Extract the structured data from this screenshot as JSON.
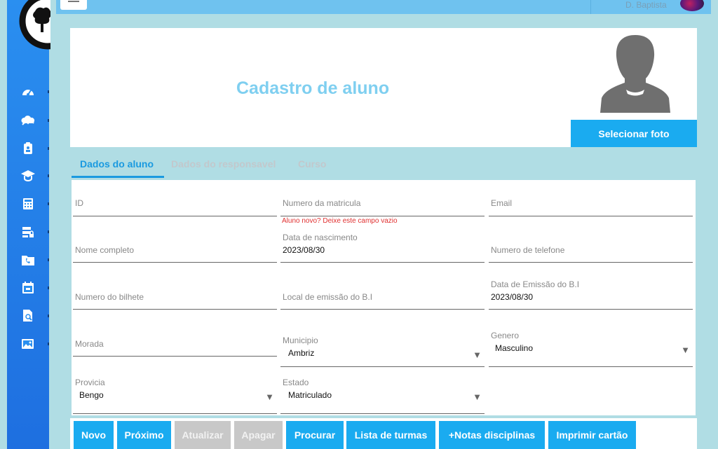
{
  "topbar": {
    "user_name": "D. Baptista"
  },
  "sidebar": {
    "items": [
      {
        "icon": "dashboard-icon"
      },
      {
        "icon": "cloud-chart-icon"
      },
      {
        "icon": "clipboard-user-icon"
      },
      {
        "icon": "graduation-cap-icon"
      },
      {
        "icon": "calculator-icon"
      },
      {
        "icon": "server-lock-icon"
      },
      {
        "icon": "phone-folder-icon"
      },
      {
        "icon": "calendar-icon"
      },
      {
        "icon": "document-search-icon"
      },
      {
        "icon": "gallery-icon"
      }
    ]
  },
  "header": {
    "title": "Cadastro de aluno",
    "photo_button": "Selecionar foto"
  },
  "tabs": [
    "Dados do aluno",
    "Dados do responsavel",
    "Curso"
  ],
  "form": {
    "id_label": "ID",
    "matricula_label": "Numero da matricula",
    "matricula_hint": "Aluno novo? Deixe este campo vazio",
    "email_label": "Email",
    "nome_label": "Nome completo",
    "nascimento_label": "Data de nascimento",
    "nascimento_value": "2023/08/30",
    "telefone_label": "Numero de telefone",
    "bilhete_label": "Numero do bilhete",
    "local_emissao_label": "Local de emissão do B.I",
    "data_emissao_label": "Data de Emissão do B.I",
    "data_emissao_value": "2023/08/30",
    "morada_label": "Morada",
    "municipio_label": "Municipio",
    "municipio_value": "Ambriz",
    "genero_label": "Genero",
    "genero_value": "Masculino",
    "provincia_label": "Provicia",
    "provincia_value": "Bengo",
    "estado_label": "Estado",
    "estado_value": "Matriculado",
    "arrow": "▼"
  },
  "actions": {
    "novo": "Novo",
    "proximo": "Próximo",
    "atualizar": "Atualizar",
    "apagar": "Apagar",
    "procurar": "Procurar",
    "lista_turmas": "Lista de turmas",
    "notas": "+Notas disciplinas",
    "imprimir": "Imprimir cartão"
  },
  "colors": {
    "accent": "#1aabf0",
    "sidebar": "#2a8ff0",
    "background": "#b0dde4",
    "error": "#e03030"
  }
}
